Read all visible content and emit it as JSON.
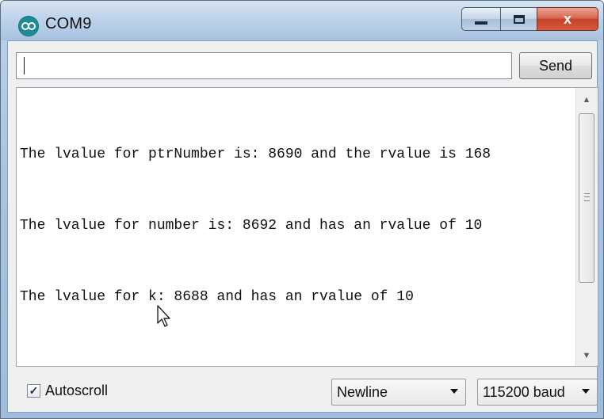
{
  "window": {
    "title": "COM9",
    "icon": "arduino-infinity-icon",
    "controls": [
      "minimize-icon",
      "maximize-icon",
      "close-icon"
    ],
    "close_glyph": "x"
  },
  "input": {
    "value": "",
    "placeholder": ""
  },
  "toolbar": {
    "send_label": "Send"
  },
  "output": {
    "lines": [
      "The lvalue for ptrNumber is: 8690 and the rvalue is 168",
      "The lvalue for number is: 8692 and has an rvalue of 10",
      "The lvalue for k: 8688 and has an rvalue of 10"
    ]
  },
  "footer": {
    "autoscroll_label": "Autoscroll",
    "autoscroll_checked": true,
    "line_ending": "Newline",
    "baud_rate": "115200 baud"
  },
  "colors": {
    "titlebar": "#bed3ea",
    "close_button": "#c4422a",
    "icon": "#1f8c95"
  }
}
